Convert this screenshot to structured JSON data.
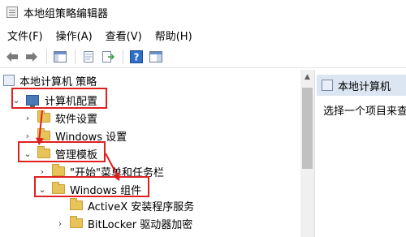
{
  "window": {
    "title": "本地组策略编辑器"
  },
  "menu": {
    "items": [
      "文件(F)",
      "操作(A)",
      "查看(V)",
      "帮助(H)"
    ]
  },
  "toolbar": {
    "icons": [
      "back-arrow-icon",
      "forward-arrow-icon",
      "show-hide-tree-icon",
      "properties-icon",
      "export-list-icon",
      "help-icon",
      "view-pane-icon"
    ]
  },
  "tree": {
    "root": "本地计算机 策略",
    "computer_config": "计算机配置",
    "software_settings": "软件设置",
    "windows_settings": "Windows 设置",
    "admin_templates": "管理模板",
    "start_menu": "\"开始\"菜单和任务栏",
    "windows_components": "Windows 组件",
    "activex": "ActiveX 安装程序服务",
    "bitlocker": "BitLocker 驱动器加密"
  },
  "right_pane": {
    "header": "本地计算机",
    "text": "选择一个项目来查"
  },
  "colors": {
    "highlight": "#e02020",
    "folder": "#e8c35a",
    "header_bg": "#dce6f2"
  }
}
